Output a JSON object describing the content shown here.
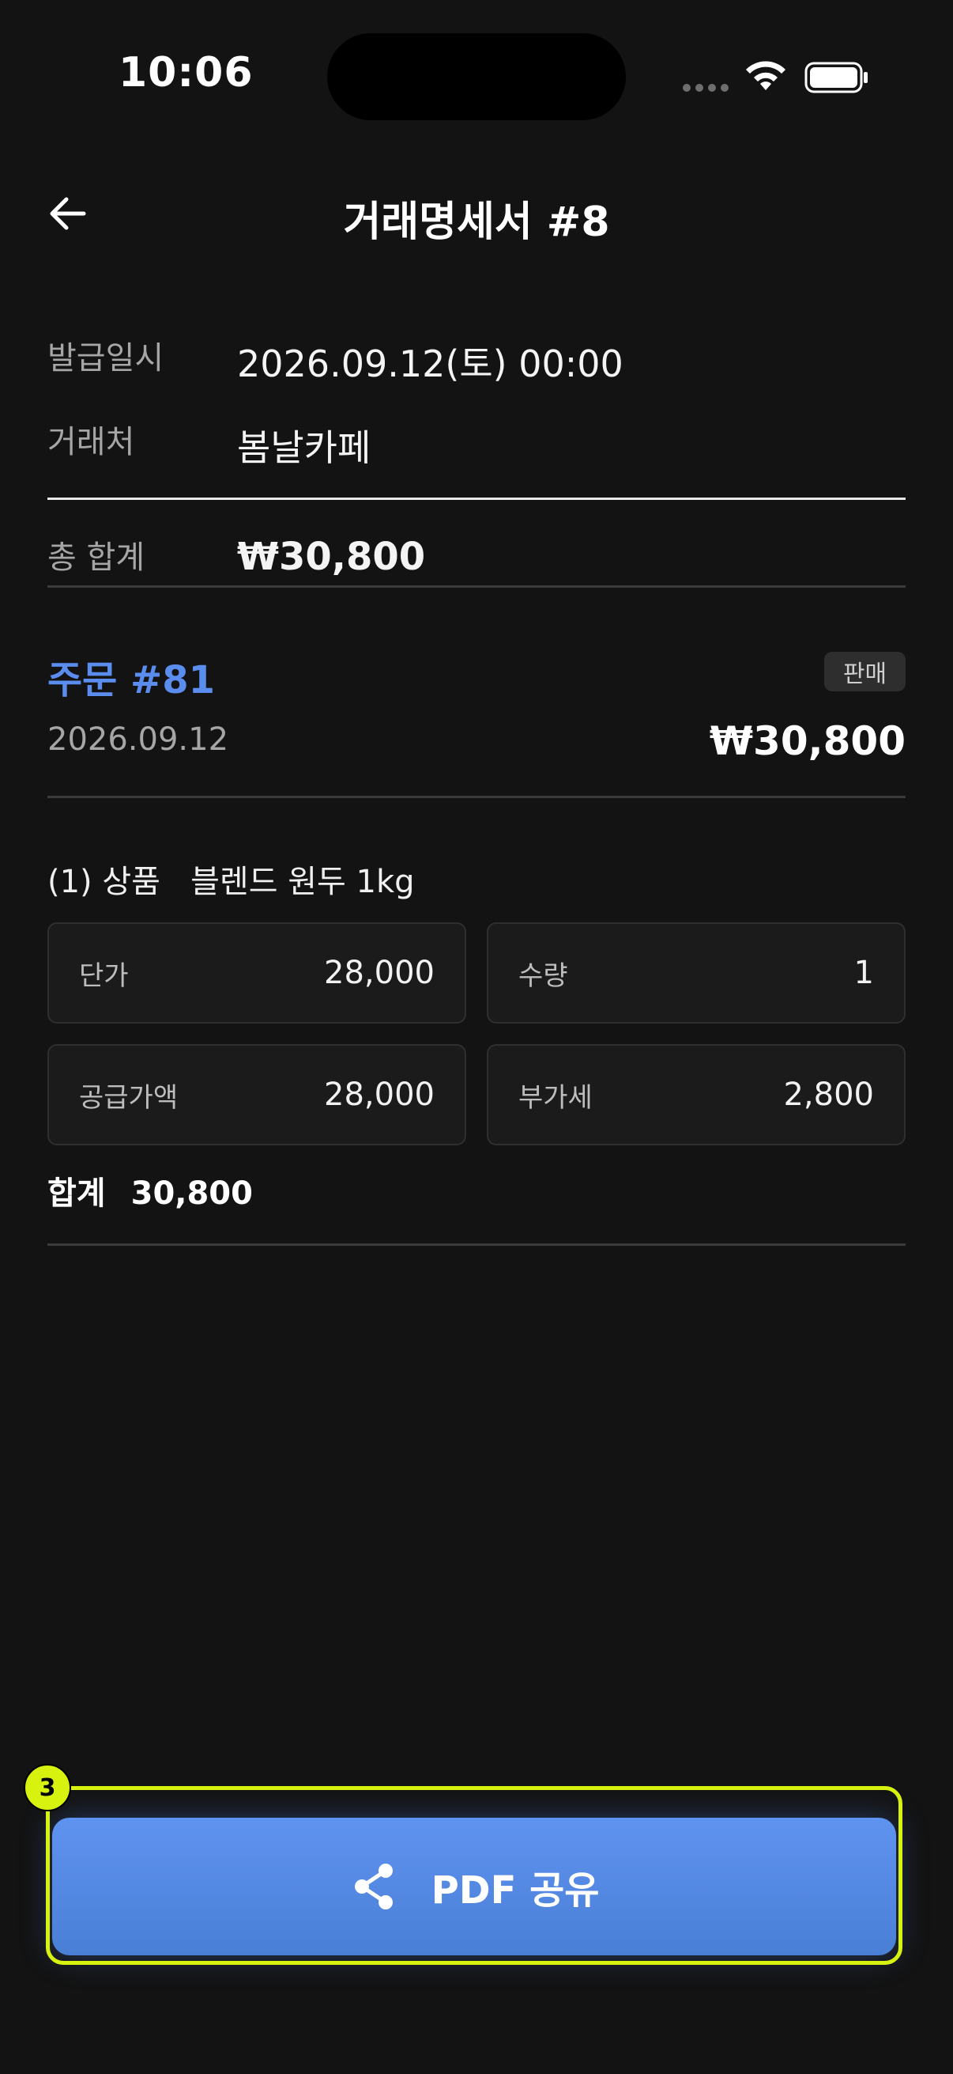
{
  "status": {
    "time": "10:06"
  },
  "header": {
    "title": "거래명세서 #8"
  },
  "info": {
    "issued_label": "발급일시",
    "issued_value": "2026.09.12(토) 00:00",
    "partner_label": "거래처",
    "partner_value": "봄날카페",
    "total_label": "총 합계",
    "total_value": "₩30,800"
  },
  "order": {
    "title": "주문 #81",
    "badge": "판매",
    "date": "2026.09.12",
    "amount": "₩30,800"
  },
  "item": {
    "line": "(1) 상품   블렌드 원두 1kg",
    "unit_price_label": "단가",
    "unit_price_value": "28,000",
    "quantity_label": "수량",
    "quantity_value": "1",
    "supply_label": "공급가액",
    "supply_value": "28,000",
    "vat_label": "부가세",
    "vat_value": "2,800",
    "sum_label": "합계",
    "sum_value": "30,800"
  },
  "action": {
    "share_label": "PDF 공유",
    "step_number": "3",
    "highlight_color": "#d7f20f",
    "button_color": "#5b8def"
  },
  "icons": {
    "back": "arrow-left-icon",
    "share": "share-icon",
    "wifi": "wifi-icon",
    "battery": "battery-icon"
  }
}
